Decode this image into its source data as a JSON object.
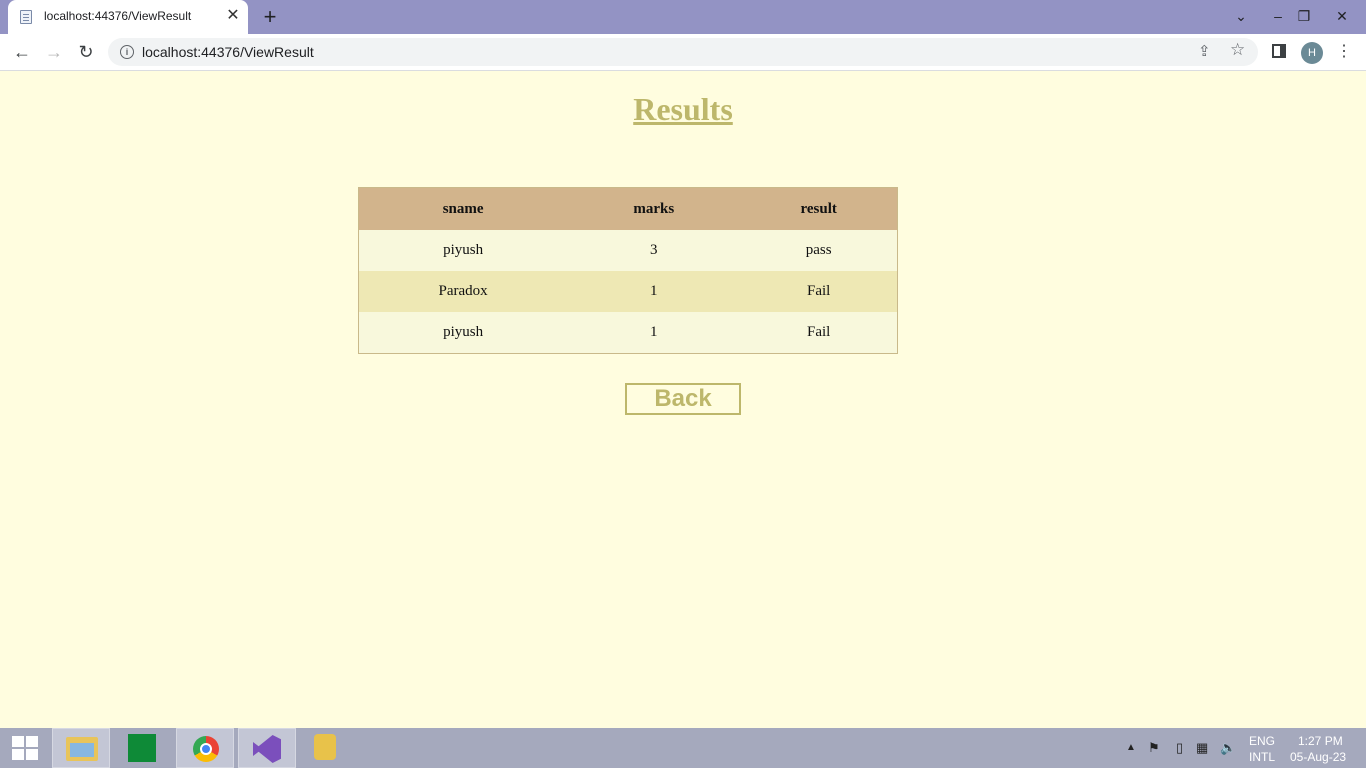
{
  "browser": {
    "tab_title": "localhost:44376/ViewResult",
    "url": "localhost:44376/ViewResult",
    "profile_initial": "H"
  },
  "page": {
    "heading": "Results",
    "table": {
      "headers": [
        "sname",
        "marks",
        "result"
      ],
      "rows": [
        [
          "piyush",
          "3",
          "pass"
        ],
        [
          "Paradox",
          "1",
          "Fail"
        ],
        [
          "piyush",
          "1",
          "Fail"
        ]
      ]
    },
    "back_label": "Back"
  },
  "taskbar": {
    "lang_top": "ENG",
    "lang_bottom": "INTL",
    "time": "1:27 PM",
    "date": "05-Aug-23"
  }
}
